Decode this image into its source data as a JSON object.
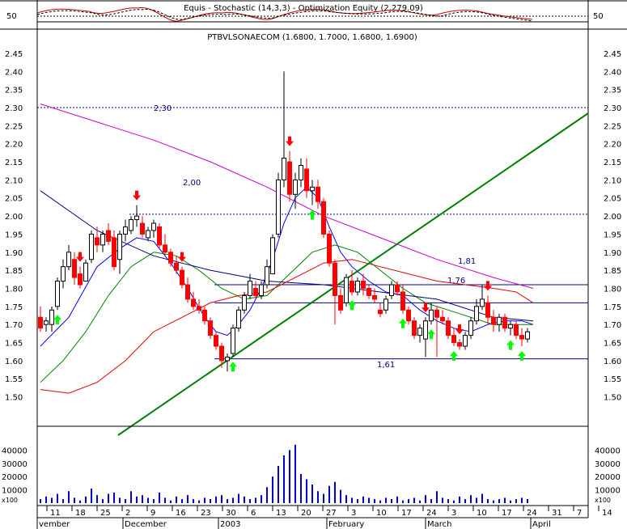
{
  "header": {
    "indicator_title": "Equis - Stochastic (14,3,3)  -  Optimization Equity (2,279.09)",
    "indicator_level": "50",
    "price_title": "PTBVLSONAECOM (1.6800, 1.7000, 1.6800, 1.6900)"
  },
  "axes": {
    "price_ticks": [
      "2.45",
      "2.40",
      "2.35",
      "2.30",
      "2.25",
      "2.20",
      "2.15",
      "2.10",
      "2.05",
      "2.00",
      "1.95",
      "1.90",
      "1.85",
      "1.80",
      "1.75",
      "1.70",
      "1.65",
      "1.60",
      "1.55",
      "1.50"
    ],
    "volume_ticks": [
      "40000",
      "30000",
      "20000",
      "10000"
    ],
    "volume_unit": "x100",
    "date_ticks": [
      "11",
      "18",
      "25",
      "2",
      "9",
      "16",
      "23",
      "30",
      "6",
      "13",
      "20",
      "27",
      "3",
      "10",
      "17",
      "24",
      "3",
      "10",
      "17",
      "24",
      "31",
      "7",
      "14"
    ],
    "months": [
      "vember",
      "December",
      "2003",
      "February",
      "March",
      "April"
    ]
  },
  "annotations": {
    "level_230": "2,30",
    "level_200": "2,00",
    "level_181": "1,81",
    "level_176": "1,76",
    "level_161": "1,61"
  },
  "chart_data": {
    "type": "candlestick",
    "title": "PTBVLSONAECOM (1.6800, 1.7000, 1.6800, 1.6900)",
    "ylim": [
      1.47,
      2.47
    ],
    "volume_ylim": [
      0,
      50000
    ],
    "reference_levels": [
      {
        "label": "2,30",
        "value": 2.3,
        "style": "dotted"
      },
      {
        "label": "2,00",
        "value": 2.005,
        "style": "dotted"
      },
      {
        "label": "1,81",
        "value": 1.81,
        "style": "solid"
      },
      {
        "label": "1,76",
        "value": 1.76,
        "style": "solid"
      },
      {
        "label": "1,61",
        "value": 1.605,
        "style": "solid"
      }
    ],
    "trendline": {
      "from": [
        0,
        1.45
      ],
      "to": [
        176,
        2.23
      ]
    },
    "ohlc": [
      [
        1.72,
        1.75,
        1.68,
        1.69
      ],
      [
        1.7,
        1.72,
        1.68,
        1.71
      ],
      [
        1.7,
        1.75,
        1.68,
        1.74
      ],
      [
        1.75,
        1.83,
        1.74,
        1.82
      ],
      [
        1.82,
        1.88,
        1.8,
        1.86
      ],
      [
        1.86,
        1.92,
        1.85,
        1.9
      ],
      [
        1.88,
        1.9,
        1.81,
        1.83
      ],
      [
        1.84,
        1.86,
        1.8,
        1.81
      ],
      [
        1.82,
        1.88,
        1.82,
        1.87
      ],
      [
        1.88,
        1.96,
        1.87,
        1.95
      ],
      [
        1.94,
        1.97,
        1.9,
        1.92
      ],
      [
        1.92,
        1.96,
        1.9,
        1.95
      ],
      [
        1.96,
        1.98,
        1.92,
        1.93
      ],
      [
        1.94,
        1.96,
        1.85,
        1.86
      ],
      [
        1.88,
        1.96,
        1.84,
        1.95
      ],
      [
        1.95,
        1.99,
        1.93,
        1.97
      ],
      [
        1.96,
        2.0,
        1.95,
        1.99
      ],
      [
        1.99,
        2.03,
        1.97,
        2.0
      ],
      [
        1.98,
        2.0,
        1.94,
        1.95
      ],
      [
        1.94,
        1.97,
        1.93,
        1.96
      ],
      [
        1.96,
        1.99,
        1.94,
        1.98
      ],
      [
        1.97,
        1.98,
        1.91,
        1.92
      ],
      [
        1.92,
        1.95,
        1.89,
        1.9
      ],
      [
        1.9,
        1.91,
        1.86,
        1.87
      ],
      [
        1.87,
        1.89,
        1.84,
        1.85
      ],
      [
        1.85,
        1.86,
        1.8,
        1.81
      ],
      [
        1.81,
        1.83,
        1.76,
        1.77
      ],
      [
        1.77,
        1.79,
        1.74,
        1.75
      ],
      [
        1.75,
        1.77,
        1.73,
        1.74
      ],
      [
        1.74,
        1.75,
        1.7,
        1.71
      ],
      [
        1.71,
        1.72,
        1.66,
        1.67
      ],
      [
        1.67,
        1.68,
        1.63,
        1.64
      ],
      [
        1.64,
        1.65,
        1.58,
        1.6
      ],
      [
        1.6,
        1.62,
        1.57,
        1.61
      ],
      [
        1.62,
        1.7,
        1.61,
        1.69
      ],
      [
        1.69,
        1.75,
        1.68,
        1.74
      ],
      [
        1.74,
        1.79,
        1.73,
        1.78
      ],
      [
        1.78,
        1.84,
        1.77,
        1.82
      ],
      [
        1.8,
        1.82,
        1.77,
        1.78
      ],
      [
        1.78,
        1.82,
        1.77,
        1.81
      ],
      [
        1.81,
        1.88,
        1.8,
        1.86
      ],
      [
        1.84,
        1.95,
        1.84,
        1.94
      ],
      [
        1.95,
        2.12,
        1.94,
        2.1
      ],
      [
        2.1,
        2.4,
        2.08,
        2.16
      ],
      [
        2.15,
        2.18,
        2.04,
        2.06
      ],
      [
        2.06,
        2.12,
        2.02,
        2.1
      ],
      [
        2.1,
        2.16,
        2.08,
        2.14
      ],
      [
        2.13,
        2.16,
        2.05,
        2.07
      ],
      [
        2.07,
        2.1,
        2.03,
        2.08
      ],
      [
        2.08,
        2.1,
        2.02,
        2.04
      ],
      [
        2.04,
        2.05,
        1.94,
        1.95
      ],
      [
        1.95,
        1.96,
        1.86,
        1.87
      ],
      [
        1.87,
        1.88,
        1.7,
        1.78
      ],
      [
        1.78,
        1.8,
        1.73,
        1.74
      ],
      [
        1.76,
        1.84,
        1.75,
        1.83
      ],
      [
        1.82,
        1.85,
        1.78,
        1.79
      ],
      [
        1.79,
        1.83,
        1.78,
        1.82
      ],
      [
        1.82,
        1.84,
        1.78,
        1.8
      ],
      [
        1.8,
        1.81,
        1.77,
        1.78
      ],
      [
        1.78,
        1.8,
        1.76,
        1.77
      ],
      [
        1.74,
        1.76,
        1.72,
        1.73
      ],
      [
        1.74,
        1.78,
        1.73,
        1.77
      ],
      [
        1.78,
        1.82,
        1.77,
        1.81
      ],
      [
        1.81,
        1.82,
        1.78,
        1.79
      ],
      [
        1.79,
        1.81,
        1.73,
        1.74
      ],
      [
        1.74,
        1.75,
        1.7,
        1.71
      ],
      [
        1.71,
        1.72,
        1.66,
        1.67
      ],
      [
        1.67,
        1.7,
        1.65,
        1.69
      ],
      [
        1.66,
        1.72,
        1.61,
        1.71
      ],
      [
        1.71,
        1.76,
        1.7,
        1.74
      ],
      [
        1.74,
        1.75,
        1.61,
        1.72
      ],
      [
        1.72,
        1.74,
        1.7,
        1.71
      ],
      [
        1.71,
        1.72,
        1.66,
        1.67
      ],
      [
        1.67,
        1.69,
        1.64,
        1.65
      ],
      [
        1.65,
        1.66,
        1.63,
        1.64
      ],
      [
        1.64,
        1.68,
        1.63,
        1.67
      ],
      [
        1.67,
        1.72,
        1.66,
        1.71
      ],
      [
        1.71,
        1.77,
        1.7,
        1.75
      ],
      [
        1.75,
        1.81,
        1.74,
        1.77
      ],
      [
        1.76,
        1.78,
        1.7,
        1.72
      ],
      [
        1.72,
        1.74,
        1.68,
        1.7
      ],
      [
        1.7,
        1.73,
        1.68,
        1.72
      ],
      [
        1.72,
        1.73,
        1.68,
        1.69
      ],
      [
        1.69,
        1.71,
        1.67,
        1.7
      ],
      [
        1.7,
        1.71,
        1.66,
        1.67
      ],
      [
        1.67,
        1.69,
        1.64,
        1.66
      ],
      [
        1.66,
        1.69,
        1.65,
        1.68
      ]
    ],
    "volume": [
      3000,
      5000,
      4000,
      7000,
      3000,
      9000,
      4000,
      2000,
      5000,
      11000,
      6000,
      3000,
      7000,
      8000,
      4000,
      3000,
      9000,
      5000,
      6000,
      4000,
      3000,
      8000,
      4000,
      2000,
      5000,
      3000,
      6000,
      3000,
      2000,
      4000,
      3000,
      5000,
      6000,
      3000,
      4000,
      7000,
      5000,
      3000,
      4000,
      6000,
      12000,
      20000,
      28000,
      36000,
      40000,
      44000,
      22000,
      18000,
      14000,
      9000,
      7000,
      13000,
      16000,
      10000,
      6000,
      4000,
      3000,
      5000,
      4000,
      3000,
      2000,
      4000,
      3000,
      5000,
      2000,
      3000,
      4000,
      2000,
      6000,
      3000,
      9000,
      4000,
      3000,
      2000,
      5000,
      3000,
      6000,
      4000,
      7000,
      3000,
      2000,
      3000,
      4000,
      2000,
      3000,
      4000,
      3000
    ],
    "lines": {
      "blue_fast": [
        [
          0,
          1.64
        ],
        [
          5,
          1.72
        ],
        [
          10,
          1.86
        ],
        [
          14,
          1.91
        ],
        [
          17,
          1.94
        ],
        [
          20,
          1.93
        ],
        [
          23,
          1.87
        ],
        [
          26,
          1.8
        ],
        [
          29,
          1.72
        ],
        [
          31,
          1.68
        ],
        [
          33,
          1.67
        ],
        [
          35,
          1.7
        ],
        [
          37,
          1.74
        ],
        [
          39,
          1.8
        ],
        [
          41,
          1.88
        ],
        [
          43,
          1.98
        ],
        [
          45,
          2.05
        ],
        [
          47,
          2.08
        ],
        [
          49,
          2.05
        ],
        [
          51,
          1.97
        ],
        [
          53,
          1.9
        ],
        [
          55,
          1.86
        ],
        [
          58,
          1.82
        ],
        [
          61,
          1.79
        ],
        [
          64,
          1.78
        ],
        [
          67,
          1.74
        ],
        [
          70,
          1.71
        ],
        [
          73,
          1.69
        ],
        [
          76,
          1.68
        ],
        [
          79,
          1.7
        ],
        [
          82,
          1.71
        ],
        [
          85,
          1.71
        ],
        [
          87,
          1.7
        ]
      ],
      "green_mid": [
        [
          0,
          1.54
        ],
        [
          4,
          1.6
        ],
        [
          8,
          1.68
        ],
        [
          12,
          1.78
        ],
        [
          16,
          1.86
        ],
        [
          20,
          1.9
        ],
        [
          24,
          1.89
        ],
        [
          28,
          1.85
        ],
        [
          32,
          1.8
        ],
        [
          36,
          1.77
        ],
        [
          40,
          1.78
        ],
        [
          44,
          1.84
        ],
        [
          48,
          1.9
        ],
        [
          52,
          1.92
        ],
        [
          56,
          1.9
        ],
        [
          60,
          1.85
        ],
        [
          64,
          1.8
        ],
        [
          68,
          1.76
        ],
        [
          72,
          1.74
        ],
        [
          76,
          1.72
        ],
        [
          80,
          1.7
        ],
        [
          84,
          1.7
        ],
        [
          87,
          1.7
        ]
      ],
      "dark_blue": [
        [
          0,
          2.07
        ],
        [
          10,
          1.96
        ],
        [
          20,
          1.89
        ],
        [
          30,
          1.85
        ],
        [
          40,
          1.82
        ],
        [
          50,
          1.81
        ],
        [
          60,
          1.79
        ],
        [
          70,
          1.77
        ],
        [
          80,
          1.72
        ],
        [
          87,
          1.71
        ]
      ],
      "red_slow": [
        [
          0,
          1.52
        ],
        [
          5,
          1.51
        ],
        [
          10,
          1.54
        ],
        [
          15,
          1.6
        ],
        [
          20,
          1.68
        ],
        [
          25,
          1.72
        ],
        [
          30,
          1.76
        ],
        [
          35,
          1.78
        ],
        [
          40,
          1.79
        ],
        [
          45,
          1.83
        ],
        [
          50,
          1.87
        ],
        [
          55,
          1.88
        ],
        [
          60,
          1.86
        ],
        [
          65,
          1.84
        ],
        [
          70,
          1.82
        ],
        [
          75,
          1.81
        ],
        [
          80,
          1.8
        ],
        [
          84,
          1.79
        ],
        [
          87,
          1.76
        ]
      ],
      "magenta": [
        [
          0,
          2.31
        ],
        [
          10,
          2.26
        ],
        [
          20,
          2.21
        ],
        [
          30,
          2.15
        ],
        [
          40,
          2.08
        ],
        [
          50,
          2.0
        ],
        [
          60,
          1.94
        ],
        [
          70,
          1.88
        ],
        [
          80,
          1.83
        ],
        [
          87,
          1.8
        ]
      ]
    },
    "signals_up": [
      3,
      34,
      48,
      55,
      64,
      69,
      73,
      83,
      85
    ],
    "signals_down": [
      7,
      17,
      25,
      44,
      68,
      74,
      79
    ],
    "xlabel": "",
    "ylabel": ""
  }
}
